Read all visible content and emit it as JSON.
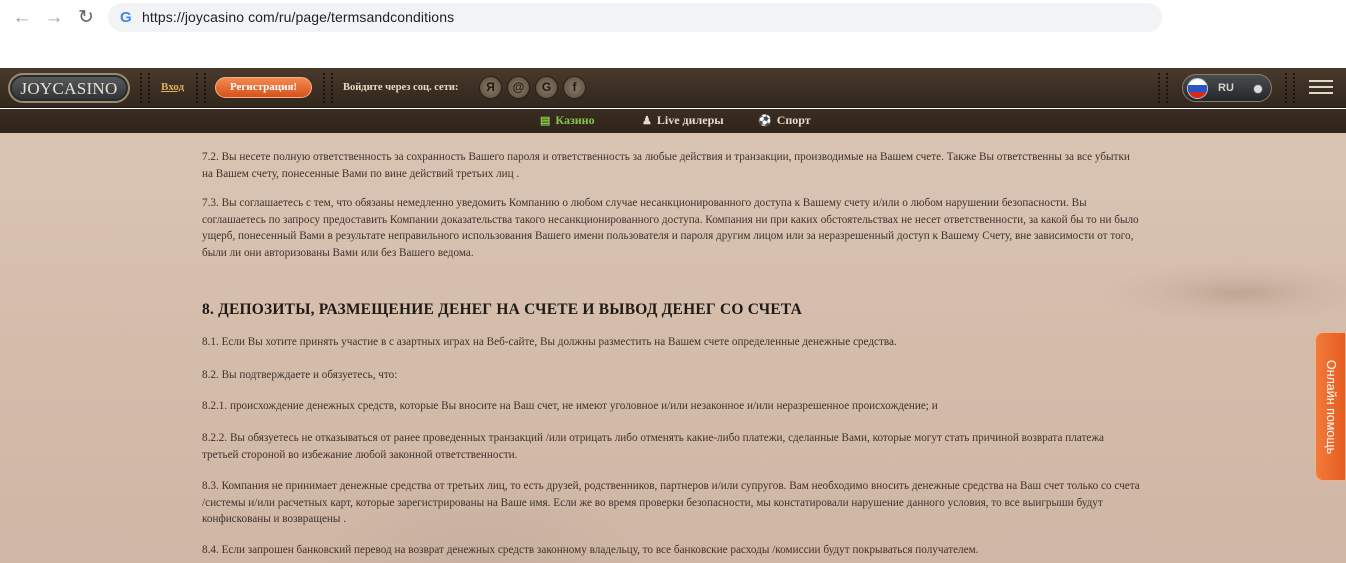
{
  "browser": {
    "url": "https://joycasino com/ru/page/termsandconditions",
    "back_icon": "arrow-left",
    "forward_icon": "arrow-right",
    "reload_icon": "reload",
    "site_icon": "G"
  },
  "header": {
    "logo_text": "JOYCASINO",
    "login_label": "Вход",
    "register_label": "Регистрация!",
    "social_label": "Войдите через соц. сети:",
    "social_icons": [
      "Я",
      "@",
      "G",
      "f"
    ],
    "language": "RU"
  },
  "subnav": {
    "items": [
      {
        "label": "Казино",
        "icon": "slots-icon",
        "active": true
      },
      {
        "label": "Live дилеры",
        "icon": "dealer-icon",
        "active": false
      },
      {
        "label": "Спорт",
        "icon": "ball-icon",
        "active": false
      }
    ]
  },
  "content": {
    "p_7_2": "7.2. Вы несете полную ответственность за сохранность Вашего пароля и ответственность за любые действия и транзакции, производимые на Вашем счете. Также Вы ответственны за все убытки на Вашем счету, понесенные Вами по вине действий третьих лиц .",
    "p_7_3": "7.3. Вы соглашаетесь с тем, что обязаны немедленно уведомить Компанию о любом случае несанкционированного доступа к Вашему счету и/или о любом нарушении безопасности. Вы соглашаетесь по запросу предоставить Компании доказательства такого несанкционированного доступа. Компания ни при каких обстоятельствах не несет ответственности, за какой бы то ни было ущерб, понесенный Вами в результате неправильного использования Вашего имени пользователя и пароля другим лицом или за неразрешенный доступ к Вашему Счету, вне зависимости от того, были ли они авторизованы Вами или без Вашего ведома.",
    "heading_8": "8. ДЕПОЗИТЫ, РАЗМЕЩЕНИЕ ДЕНЕГ НА СЧЕТЕ И ВЫВОД ДЕНЕГ СО СЧЕТА",
    "p_8_1": "8.1. Если Вы хотите принять участие в с азартных играх на Веб-сайте, Вы должны разместить на Вашем счете определенные денежные средства.",
    "p_8_2": "8.2. Вы подтверждаете и обязуетесь, что:",
    "p_8_2_1": "8.2.1. происхождение денежных средств, которые Вы вносите на Ваш счет, не имеют уголовное и/или незаконное и/или неразрешенное происхождение; и",
    "p_8_2_2": "8.2.2. Вы обязуетесь не отказываться от ранее проведенных транзакций /или отрицать либо отменять какие-либо платежи, сделанные Вами, которые могут стать причиной возврата платежа третьей стороной во избежание любой законной ответственности.",
    "p_8_3": "8.3. Компания не принимает денежные средства от третьих лиц, то есть друзей, родственников, партнеров и/или супругов. Вам необходимо вносить денежные средства на Ваш счет только со счета /системы и/или расчетных карт, которые зарегистрированы на Ваше имя. Если же во время проверки безопасности, мы констатировали нарушение данного условия, то все выигрыши будут конфискованы и возвращены .",
    "p_8_4": "8.4. Если запрошен банковский перевод на возврат денежных средств законному владельцу, то все банковские расходы /комиссии будут покрываться получателем."
  },
  "help_tab": {
    "label": "Онлайн помощь"
  }
}
